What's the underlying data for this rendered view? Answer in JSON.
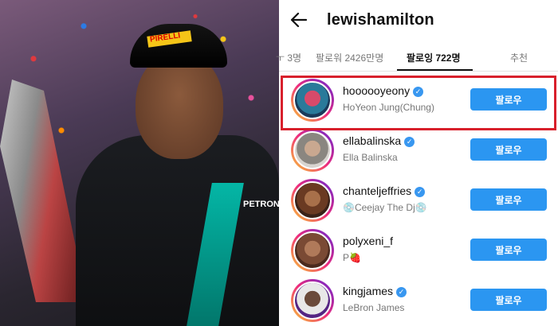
{
  "profile": {
    "username": "lewishamilton"
  },
  "tabs": [
    {
      "label": "ㅜ 3명"
    },
    {
      "label": "팔로워 2426만명"
    },
    {
      "label": "팔로잉 722명",
      "active": true
    },
    {
      "label": "추천"
    }
  ],
  "following": [
    {
      "username": "hoooooyeony",
      "fullname": "HoYeon Jung(Chung)",
      "verified": true,
      "button": "팔로우",
      "highlighted": true
    },
    {
      "username": "ellabalinska",
      "fullname": "Ella Balinska",
      "verified": true,
      "button": "팔로우"
    },
    {
      "username": "chanteljeffries",
      "fullname": "💿Ceejay The Dj💿",
      "verified": true,
      "button": "팔로우"
    },
    {
      "username": "polyxeni_f",
      "fullname": "P🍓",
      "verified": false,
      "button": "팔로우"
    },
    {
      "username": "kingjames",
      "fullname": "LeBron James",
      "verified": true,
      "button": "팔로우"
    }
  ],
  "photo": {
    "cap_text": "PIRELLI",
    "suit_text": "PETRONAS"
  },
  "colors": {
    "follow_button": "#2b96f1",
    "verified_badge": "#3897f0",
    "highlight_border": "#d8202c"
  }
}
